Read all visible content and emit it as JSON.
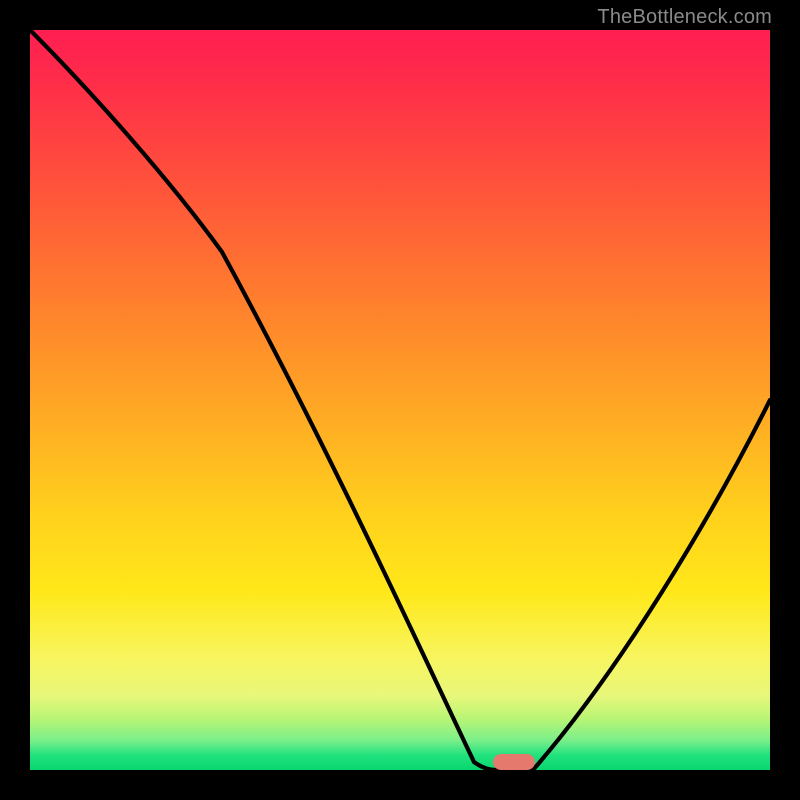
{
  "watermark": "TheBottleneck.com",
  "colors": {
    "frame": "#000000",
    "curve": "#000000",
    "marker": "#e5796e"
  },
  "chart_data": {
    "type": "line",
    "title": "",
    "xlabel": "",
    "ylabel": "",
    "xlim": [
      0,
      100
    ],
    "ylim": [
      0,
      100
    ],
    "x": [
      0,
      26,
      60,
      63,
      68,
      100
    ],
    "values": [
      100,
      70,
      1,
      0,
      0,
      50
    ],
    "marker": {
      "x": 65.5,
      "y": 0,
      "width_pct": 5.7,
      "height_pct": 2.2
    },
    "notes": "Bottleneck-style curve: steep descent from top-left, minimum plateau around x≈63–68% at y≈0, then rise to ≈50% at right edge. Values read approximately from plot pixels."
  }
}
